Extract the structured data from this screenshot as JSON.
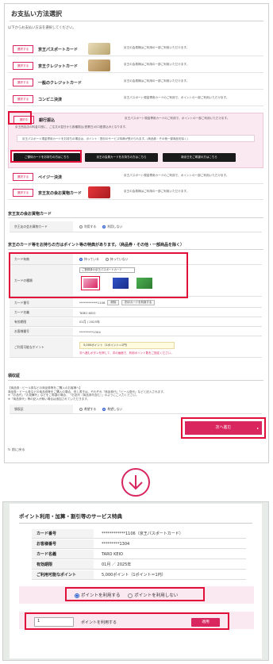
{
  "top": {
    "title": "お支払い方法選択",
    "instruction": "以下からお支払い方法を選択してください。",
    "select_label": "選択する",
    "selected_label": "選択中",
    "methods": [
      {
        "name": "京王パスポートカード",
        "desc": "京王の会員様はご利用の一部ご利用いただけます。",
        "thumb": "#d7c9a3"
      },
      {
        "name": "京王クレジットカード",
        "desc": "京王の会員様はご利用の一部ご利用いただけます。",
        "thumb": "#c2a072"
      },
      {
        "name": "一般のクレジットカード",
        "desc": "京王の会員様はご利用の一部ご利用いただけます。",
        "thumb": ""
      },
      {
        "name": "コンビニ決済",
        "desc": "京王パスポート現金専用カードのご利用で、ポイントの一部ご利用いただけます。",
        "thumb": ""
      },
      {
        "name": "銀行振込",
        "desc": "京王パスポート現金専用カードのご利用で、ポイントの一部ご利用いただけます。",
        "thumb": ""
      }
    ],
    "transfer_text": "京王西友店の料金口座に、ご注文の翌日から各種振込(営業日)の口座振込みとなります。",
    "transfer_note": "京王パスポート現金専用カードをお持ちの場合は、ポイント・割引のサービス特典が受けられます。(商品券・その他一部商品を除く)",
    "bank_buttons": [
      "ご優待カードをお持ちの方はこちら",
      "京王の会員カードをお持ちの方はこちら",
      "新京王をご希望の方はこちら"
    ],
    "payeasy": {
      "name": "ペイジー決済",
      "desc": "京王パスポート現金専用カードのご利用で、ポイントの一部ご利用いただけます。"
    },
    "member_card": {
      "name": "京王友の会お買物カード",
      "desc": "京王の会員様はご利用の一部ご利用いただけます。"
    },
    "section_member": "京王友の会お買物カード",
    "member_row": {
      "label": "京王友の会お買物カード",
      "opt_use": "利用する",
      "opt_nouse": "利用しない"
    },
    "section_points": "京王のカード等をお持ちの方はポイント等の特典があります。（商品券・その他・一部商品を除く）",
    "card_yn": {
      "label": "カード有無",
      "opt_yes": "持っている",
      "opt_no": "持っていない"
    },
    "card_kind": {
      "label": "カードの種類",
      "select": "ご登録済の京王パスポートカード"
    },
    "card_number": {
      "label": "カード番号",
      "value": "************1106",
      "btn_del": "削除",
      "btn_other": "別のカードを利用する"
    },
    "card_name": {
      "label": "カード名義",
      "value": "TARO KEIO"
    },
    "expiry": {
      "label": "有効期限",
      "value": "01月 / 2025年"
    },
    "customer_no": {
      "label": "お客様番号",
      "value": "*********1304"
    },
    "points": {
      "label": "ご利用可能なポイント",
      "value": "5,000ポイント（1ポイント=1円）",
      "note": "次へ進むボタンを押して、次の画面で、利用ポイント数をご指定ください。"
    },
    "section_receipt": "領収証",
    "receipt_notes": [
      "【商品券・ビール券などの商品券等をご購入のお客様へ】",
      "商品券・ビール券などの商品券等をご購入の場合、但し書きは、それぞれ「商品券代」「ビール券代」などと記入されます。",
      "※「お品代」「お見舞代」などをご希望の場合、「お品代（商品券代含む）」のようにご入力ください。",
      "※「商品券代」等の記入が無い場合は追加されていただきます。"
    ],
    "receipt_row": {
      "label": "領収証",
      "opt_yes": "希望する",
      "opt_no": "希望しない"
    },
    "back": "前に戻る",
    "next": "次へ進む"
  },
  "bottom": {
    "title": "ポイント利用・加算・割引等のサービス特典",
    "rows": [
      {
        "label": "カード番号",
        "value": "************1106（京王パスポートカード）"
      },
      {
        "label": "お客様番号",
        "value": "*********1304"
      },
      {
        "label": "カード名義",
        "value": "TARO KEIO"
      },
      {
        "label": "有効期限",
        "value": "01月 ／ 2025年"
      },
      {
        "label": "ご利用可能なポイント",
        "value": "5,000ポイント（1ポイント＝1円）"
      }
    ],
    "opt_use_points": "ポイントを利用する",
    "opt_no_points": "ポイントを利用しない",
    "points_input": "1",
    "points_input_label": "ポイントを利用する",
    "apply": "適用"
  },
  "colors": {
    "accent": "#d9265f",
    "highlight": "#e0103a",
    "pink_band": "#fbe9f1"
  }
}
